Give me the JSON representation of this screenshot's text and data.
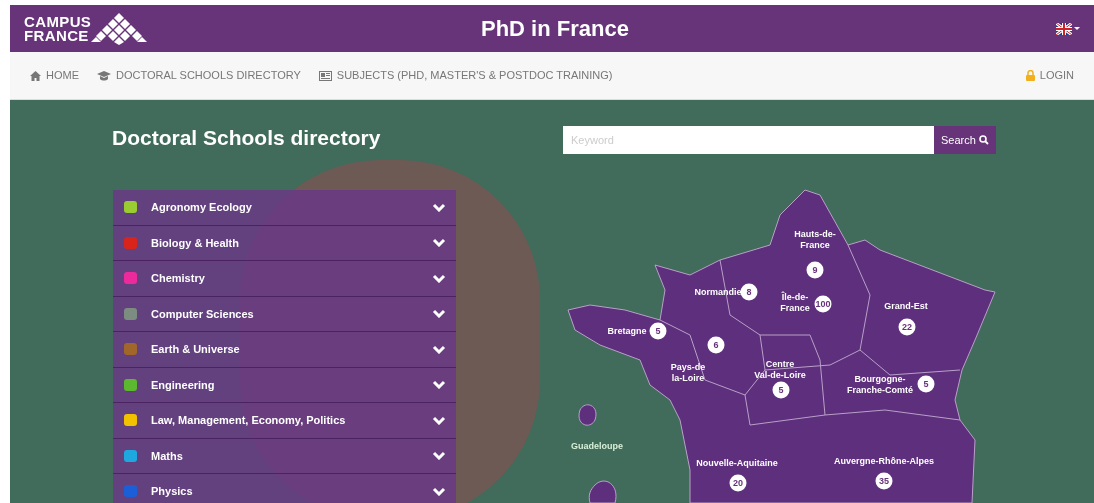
{
  "header": {
    "logo_lines": [
      "CAMPUS",
      "FRANCE"
    ],
    "title": "PhD in France"
  },
  "nav": {
    "items": [
      {
        "label": "HOME",
        "kind": "home"
      },
      {
        "label": "DOCTORAL SCHOOLS DIRECTORY",
        "kind": "cap"
      },
      {
        "label": "SUBJECTS (PHD, MASTER'S & POSTDOC TRAINING)",
        "kind": "news"
      }
    ],
    "login": "LOGIN"
  },
  "directory": {
    "title": "Doctoral Schools directory",
    "search": {
      "placeholder": "Keyword",
      "button": "Search"
    }
  },
  "categories": [
    {
      "label": "Agronomy Ecology",
      "color": "#9acd32",
      "expanded": false
    },
    {
      "label": "Biology & Health",
      "color": "#d9241c",
      "expanded": false
    },
    {
      "label": "Chemistry",
      "color": "#ec2a9b",
      "expanded": false
    },
    {
      "label": "Computer Sciences",
      "color": "#7d8c80",
      "expanded": false
    },
    {
      "label": "Earth & Universe",
      "color": "#a0662a",
      "expanded": false
    },
    {
      "label": "Engineering",
      "color": "#5cb82e",
      "expanded": false
    },
    {
      "label": "Law, Management, Economy, Politics",
      "color": "#f2c200",
      "expanded": false
    },
    {
      "label": "Maths",
      "color": "#1fa8e0",
      "expanded": false
    },
    {
      "label": "Physics",
      "color": "#1a5fd8",
      "expanded": false
    }
  ],
  "map": {
    "regions": [
      {
        "name": "Hauts-de-\nFrance",
        "count": "9"
      },
      {
        "name": "Normandie",
        "count": "8"
      },
      {
        "name": "Île-de-\nFrance",
        "count": "100"
      },
      {
        "name": "Grand-Est",
        "count": "22"
      },
      {
        "name": "Bretagne",
        "count": "5"
      },
      {
        "name": "Pays-de\nla-Loire",
        "count": "6"
      },
      {
        "name": "Centre\nVal-de-Loire",
        "count": "5"
      },
      {
        "name": "Bourgogne-\nFranche-Comté",
        "count": "5"
      },
      {
        "name": "Guadeloupe"
      },
      {
        "name": "Nouvelle-Aquitaine",
        "count": "20"
      },
      {
        "name": "Auvergne-Rhône-Alpes",
        "count": "35"
      }
    ]
  }
}
